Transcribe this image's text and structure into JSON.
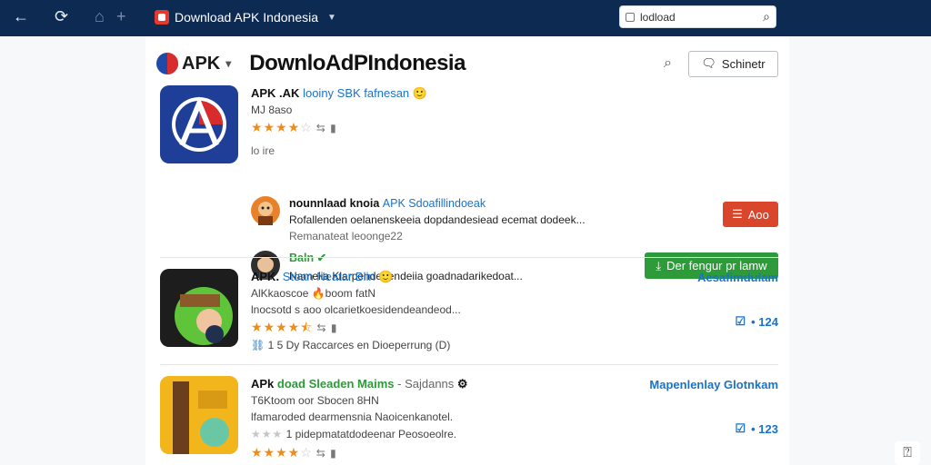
{
  "browser": {
    "tab_title": "Download APK Indonesia",
    "search_value": "lodload"
  },
  "header": {
    "brand": "APK",
    "title": "DownloAdPIndonesia",
    "button_label": "Schinetr"
  },
  "apps": [
    {
      "title": "APK .AK",
      "title_extra": "looiny SBK fafnesan",
      "sub": "MJ 8aso",
      "rating_stars": 3.5,
      "misc": "",
      "extra_line": "lo ire",
      "right_label": "",
      "right_count": ""
    },
    {
      "title": "APK.",
      "title_extra": "Stoan Neatar Blin",
      "sub": "AlKkaoscoe 🔥boom fatN",
      "desc": "lnocsotd s aoo olcarietkoesidendeandeod...",
      "rating_stars": 4.5,
      "misc": "",
      "extra_line": "1 5 Dy Raccarces en Dioeperrung (D)",
      "right_label": "Aesafimdulam",
      "right_count": "• 124"
    },
    {
      "title": "APk",
      "title_extra": "doad Sleaden Maims",
      "title_tail": "- Sajdanns",
      "sub": "T6Ktoom oor Sbocen 8HN",
      "desc": "lfamaroded dearmensnia Naoicenkanotel.",
      "desc2": "1 pidepmatatdodeenar Peosoeolre.",
      "rating_stars": 4,
      "misc": "",
      "right_label": "Mapenlenlay Glotnkam",
      "right_count": "• 123"
    }
  ],
  "reviews": [
    {
      "name": "nounnlaad knoia",
      "name_extra": "APK Sdoafillindoeak",
      "body": "Rofallenden oelanenskeeia dopdandesiead ecemat dodeek...",
      "meta": "Remanateat leoonge22",
      "button_label": "Aoo"
    },
    {
      "name": "Baln",
      "body": "Namelia Klarpendeoendeiia goadnadarikedoat...",
      "button_label": "Der fengur pr lamw"
    }
  ]
}
